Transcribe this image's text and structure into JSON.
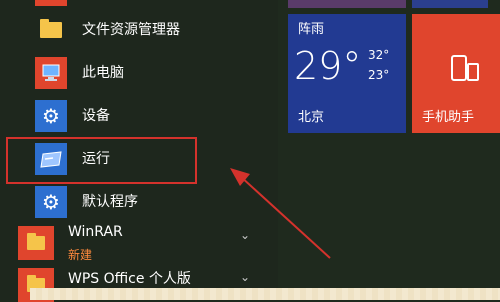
{
  "start_menu": {
    "items": [
      {
        "label": "文件资源管理器",
        "icon": "folder-icon"
      },
      {
        "label": "此电脑",
        "icon": "computer-icon"
      },
      {
        "label": "设备",
        "icon": "gear-icon"
      },
      {
        "label": "运行",
        "icon": "run-icon"
      },
      {
        "label": "默认程序",
        "icon": "gear-icon"
      }
    ],
    "groups": [
      {
        "title": "WinRAR",
        "subtitle": "新建",
        "icon": "folder-icon"
      },
      {
        "title": "WPS Office 个人版",
        "icon": "folder-icon"
      }
    ]
  },
  "tiles": {
    "weather": {
      "condition": "阵雨",
      "temperature": "29°",
      "high": "32°",
      "low": "23°",
      "city": "北京"
    },
    "phone_assistant": {
      "label": "手机助手",
      "icon": "phone-icon"
    }
  },
  "colors": {
    "highlight": "#d4322c",
    "accent_blue": "#223a92",
    "accent_orange": "#e0452d",
    "new_label": "#ff8a3d"
  }
}
